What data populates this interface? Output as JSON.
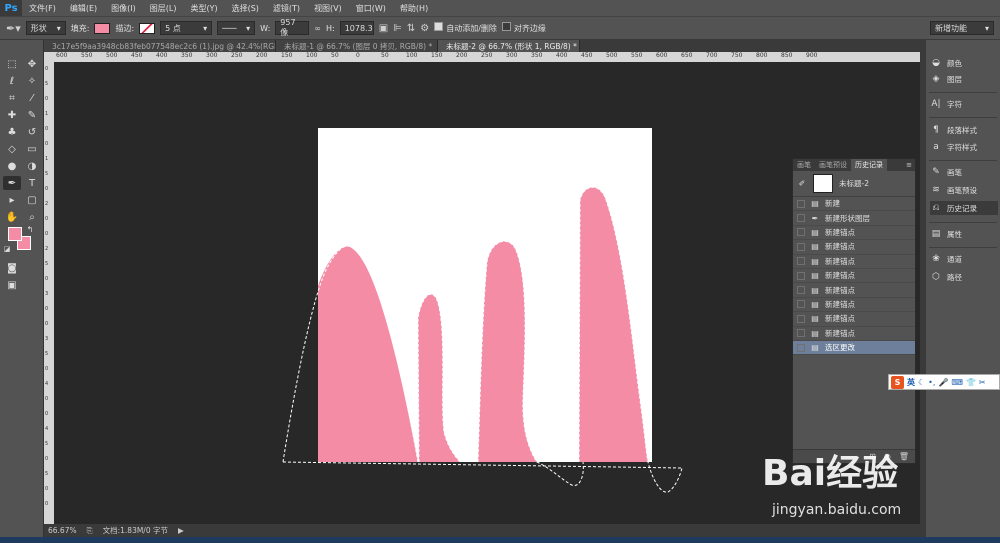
{
  "app": {
    "logo": "Ps"
  },
  "menu": [
    "文件(F)",
    "编辑(E)",
    "图像(I)",
    "图层(L)",
    "类型(Y)",
    "选择(S)",
    "滤镜(T)",
    "视图(V)",
    "窗口(W)",
    "帮助(H)"
  ],
  "options": {
    "mode": "形状",
    "fill_label": "填充:",
    "fill_color": "#f48ca6",
    "stroke_label": "描边:",
    "stroke_size": "5 点",
    "width_label": "W:",
    "width_value": "957 像",
    "height_label": "H:",
    "height_value": "1078.3",
    "auto_add_delete": "自动添加/删除",
    "align_edges": "对齐边缘",
    "workspace": "新增功能"
  },
  "tabs": [
    "3c17e5f9aa3948cb83feb077548ec2c6 (1).jpg @ 42.4%(RGB/8) *",
    "未标题-1 @ 66.7% (图层 0 拷贝, RGB/8) *",
    "未标题-2 @ 66.7% (形状 1, RGB/8) *"
  ],
  "ruler_labels": [
    "600",
    "550",
    "500",
    "450",
    "400",
    "350",
    "300",
    "250",
    "200",
    "150",
    "100",
    "50",
    "0",
    "50",
    "100",
    "150",
    "200",
    "250",
    "300",
    "350",
    "400",
    "450",
    "500",
    "550",
    "600",
    "650",
    "700",
    "750",
    "800",
    "850",
    "900"
  ],
  "vruler_labels": [
    "0",
    "5",
    "0",
    "1",
    "0",
    "0",
    "1",
    "5",
    "0",
    "2",
    "0",
    "0",
    "2",
    "5",
    "0",
    "3",
    "0",
    "0",
    "3",
    "5",
    "0",
    "4",
    "0",
    "0",
    "4",
    "5",
    "0",
    "5",
    "0",
    "0"
  ],
  "status": {
    "zoom": "66.67%",
    "doc": "文档:1.83M/0 字节"
  },
  "dock": [
    "颜色",
    "图层",
    "字符",
    "段落样式",
    "字符样式",
    "画笔",
    "画笔预设",
    "历史记录",
    "属性",
    "通道",
    "路径"
  ],
  "history": {
    "tabs": [
      "画笔",
      "画笔预设",
      "历史记录"
    ],
    "snapshot": "未标题-2",
    "items": [
      "新建",
      "新建形状图层",
      "新建锚点",
      "新建锚点",
      "新建锚点",
      "新建锚点",
      "新建锚点",
      "新建锚点",
      "新建锚点",
      "新建锚点",
      "选区更改"
    ]
  },
  "ime": {
    "lang": "英"
  },
  "watermark": {
    "brand": "Bai经验",
    "url": "jingyan.baidu.com"
  },
  "colors": {
    "foreground": "#f48ca6",
    "background": "#f48ca6",
    "shape": "#f48ca6"
  }
}
